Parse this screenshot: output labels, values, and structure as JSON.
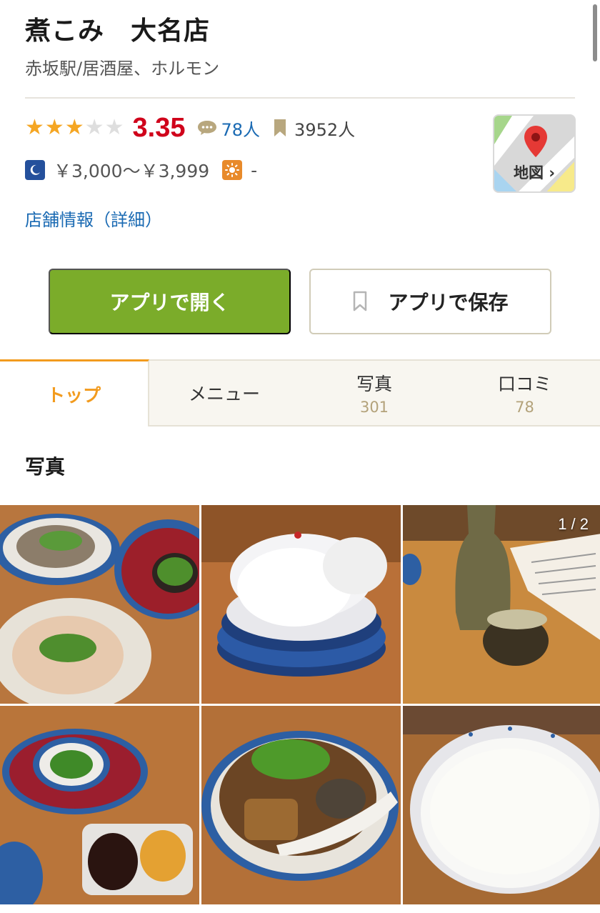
{
  "shop": {
    "name": "煮こみ　大名店",
    "subtitle": "赤坂駅/居酒屋、ホルモン",
    "rating": {
      "stars": [
        {
          "state": "on",
          "glyph": "★"
        },
        {
          "state": "on",
          "glyph": "★"
        },
        {
          "state": "on",
          "glyph": "★"
        },
        {
          "state": "off",
          "glyph": "★"
        },
        {
          "state": "off",
          "glyph": "★"
        }
      ],
      "score": "3.35",
      "review_count": "78人",
      "save_count": "3952人"
    },
    "price": {
      "dinner_icon": "moon-icon",
      "dinner": "￥3,000～￥3,999",
      "lunch_icon": "sun-icon",
      "lunch": "-"
    },
    "detail_link": "店舗情報（詳細）",
    "map": {
      "label": "地図 ›",
      "icon": "map-pin-icon"
    }
  },
  "actions": {
    "open_app": "アプリで開く",
    "save_app": "アプリで保存"
  },
  "tabs": [
    {
      "label": "トップ",
      "count": "",
      "active": true
    },
    {
      "label": "メニュー",
      "count": "",
      "active": false
    },
    {
      "label": "写真",
      "count": "301",
      "active": false
    },
    {
      "label": "口コミ",
      "count": "78",
      "active": false
    }
  ],
  "photos": {
    "title": "写真",
    "page_indicator": "1 / 2",
    "items": [
      "horumon-dishes",
      "daikon-slices",
      "sake-bottle-cup",
      "raw-meat-plate",
      "nikomi-stew",
      "rice-bowl"
    ]
  },
  "colors": {
    "brand_green": "#7bac2a",
    "score_red": "#d0021b",
    "link_blue": "#1a6ab3",
    "tab_orange": "#f29b1e",
    "star_gold": "#f5a623"
  }
}
